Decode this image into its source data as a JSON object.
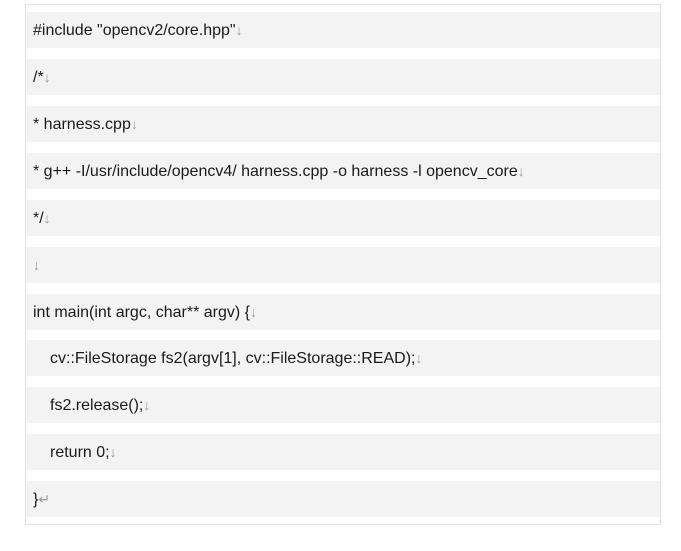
{
  "code_lines": [
    {
      "text": "#include \"opencv2/core.hpp\"",
      "mark": "↓"
    },
    {
      "text": "/*",
      "mark": "↓"
    },
    {
      "text": "* harness.cpp",
      "mark": "↓"
    },
    {
      "text": "* g++ -I/usr/include/opencv4/ harness.cpp -o harness -l opencv_core",
      "mark": "↓"
    },
    {
      "text": "*/",
      "mark": "↓"
    },
    {
      "text": "",
      "mark": "↓"
    },
    {
      "text": "int main(int argc, char** argv) {",
      "mark": "↓"
    },
    {
      "text": "cv::FileStorage fs2(argv[1], cv::FileStorage::READ);",
      "mark": "↓"
    },
    {
      "text": "fs2.release();",
      "mark": "↓"
    },
    {
      "text": "return 0;",
      "mark": "↓"
    },
    {
      "text": "}",
      "mark": "↵"
    }
  ]
}
